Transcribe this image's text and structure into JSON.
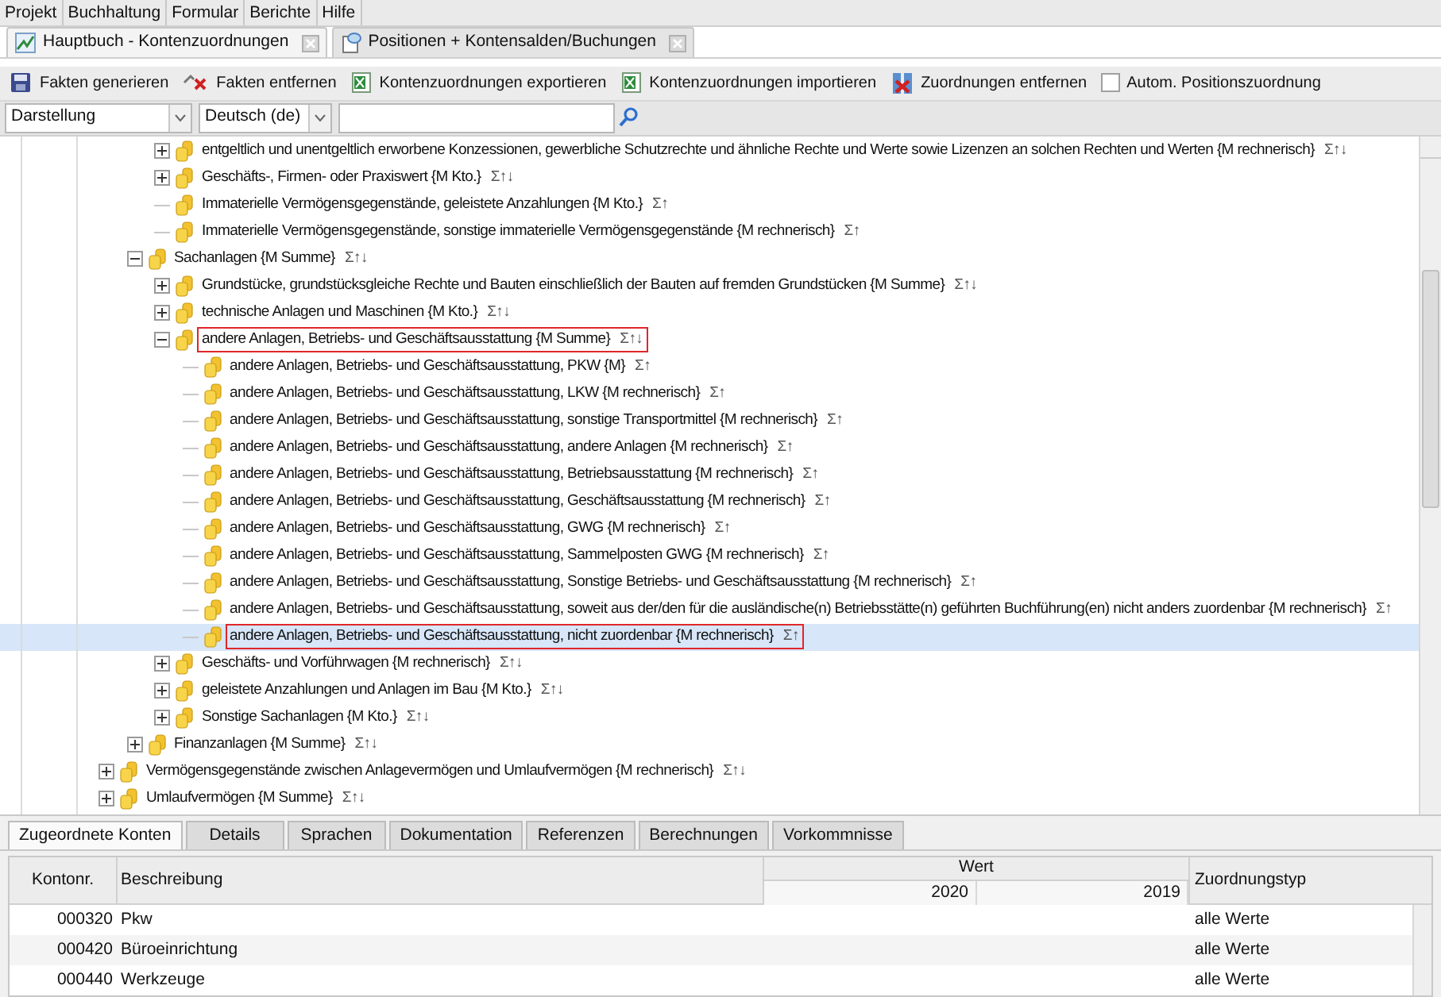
{
  "menu": [
    "Projekt",
    "Buchhaltung",
    "Formular",
    "Berichte",
    "Hilfe"
  ],
  "doc_tabs": [
    {
      "label": "Hauptbuch - Kontenzuordnungen",
      "kind": "ledger",
      "selected": true
    },
    {
      "label": "Positionen + Kontensalden/Buchungen",
      "kind": "positions",
      "selected": false
    }
  ],
  "toolbar": [
    {
      "kind": "generate",
      "label": "Fakten generieren"
    },
    {
      "kind": "remove",
      "label": "Fakten entfernen"
    },
    {
      "kind": "export",
      "label": "Kontenzuordnungen exportieren"
    },
    {
      "kind": "import",
      "label": "Kontenzuordnungen importieren"
    },
    {
      "kind": "unassign",
      "label": "Zuordnungen entfernen"
    },
    {
      "kind": "checkbox",
      "label": "Autom. Positionszuordnung",
      "checked": false
    }
  ],
  "filters": {
    "view": "Darstellung",
    "language": "Deutsch (de)"
  },
  "tree": [
    {
      "children": [
        {
          "children": [
            {
              "label": "entgeltlich und unentgeltlich erworbene Konzessionen, gewerbliche Schutzrechte und ähnliche Rechte und Werte sowie Lizenzen an solchen Rechten und Werten {M rechnerisch}",
              "flags": "Σ↑↓",
              "expanded": false,
              "selected": false,
              "marked": false
            },
            {
              "label": "Geschäfts-, Firmen- oder Praxiswert {M Kto.}",
              "flags": "Σ↑↓",
              "expanded": false,
              "selected": false,
              "marked": false
            },
            {
              "label": "Immaterielle Vermögensgegenstände, geleistete Anzahlungen {M Kto.}",
              "flags": "Σ↑",
              "selected": false,
              "marked": false
            },
            {
              "label": "Immaterielle Vermögensgegenstände, sonstige immaterielle Vermögensgegenstände {M rechnerisch}",
              "flags": "Σ↑",
              "selected": false,
              "marked": false
            }
          ]
        },
        {
          "label": "Sachanlagen {M Summe}",
          "flags": "Σ↑↓",
          "expanded": true,
          "selected": false,
          "marked": false,
          "children": [
            {
              "label": "Grundstücke, grundstücksgleiche Rechte und Bauten einschließlich der Bauten auf fremden Grundstücken {M Summe}",
              "flags": "Σ↑↓",
              "expanded": false,
              "selected": false,
              "marked": false
            },
            {
              "label": "technische Anlagen und Maschinen {M Kto.}",
              "flags": "Σ↑↓",
              "expanded": false,
              "selected": false,
              "marked": false
            },
            {
              "label": "andere Anlagen, Betriebs- und Geschäftsausstattung {M Summe}",
              "flags": "Σ↑↓",
              "expanded": true,
              "selected": false,
              "marked": true,
              "children": [
                {
                  "label": "andere Anlagen, Betriebs- und Geschäftsausstattung, PKW {M}",
                  "flags": "Σ↑",
                  "selected": false,
                  "marked": false
                },
                {
                  "label": "andere Anlagen, Betriebs- und Geschäftsausstattung, LKW {M rechnerisch}",
                  "flags": "Σ↑",
                  "selected": false,
                  "marked": false
                },
                {
                  "label": "andere Anlagen, Betriebs- und Geschäftsausstattung, sonstige Transportmittel {M rechnerisch}",
                  "flags": "Σ↑",
                  "selected": false,
                  "marked": false
                },
                {
                  "label": "andere Anlagen, Betriebs- und Geschäftsausstattung, andere Anlagen {M rechnerisch}",
                  "flags": "Σ↑",
                  "selected": false,
                  "marked": false
                },
                {
                  "label": "andere Anlagen, Betriebs- und Geschäftsausstattung, Betriebsausstattung {M rechnerisch}",
                  "flags": "Σ↑",
                  "selected": false,
                  "marked": false
                },
                {
                  "label": "andere Anlagen, Betriebs- und Geschäftsausstattung, Geschäftsausstattung {M rechnerisch}",
                  "flags": "Σ↑",
                  "selected": false,
                  "marked": false
                },
                {
                  "label": "andere Anlagen, Betriebs- und Geschäftsausstattung, GWG {M rechnerisch}",
                  "flags": "Σ↑",
                  "selected": false,
                  "marked": false
                },
                {
                  "label": "andere Anlagen, Betriebs- und Geschäftsausstattung, Sammelposten GWG {M rechnerisch}",
                  "flags": "Σ↑",
                  "selected": false,
                  "marked": false
                },
                {
                  "label": "andere Anlagen, Betriebs- und Geschäftsausstattung, Sonstige Betriebs- und Geschäftsausstattung {M rechnerisch}",
                  "flags": "Σ↑",
                  "selected": false,
                  "marked": false
                },
                {
                  "label": "andere Anlagen, Betriebs- und Geschäftsausstattung, soweit aus der/den für die ausländische(n) Betriebsstätte(n) geführten Buchführung(en) nicht anders zuordenbar {M rechnerisch}",
                  "flags": "Σ↑",
                  "selected": false,
                  "marked": false
                },
                {
                  "label": "andere Anlagen, Betriebs- und Geschäftsausstattung, nicht zuordenbar {M rechnerisch}",
                  "flags": "Σ↑",
                  "selected": true,
                  "marked": true
                }
              ]
            },
            {
              "label": "Geschäfts- und Vorführwagen {M rechnerisch}",
              "flags": "Σ↑↓",
              "expanded": false,
              "selected": false,
              "marked": false
            },
            {
              "label": "geleistete Anzahlungen und Anlagen im Bau {M Kto.}",
              "flags": "Σ↑↓",
              "expanded": false,
              "selected": false,
              "marked": false
            },
            {
              "label": "Sonstige Sachanlagen {M Kto.}",
              "flags": "Σ↑↓",
              "expanded": false,
              "selected": false,
              "marked": false
            }
          ]
        },
        {
          "label": "Finanzanlagen {M Summe}",
          "flags": "Σ↑↓",
          "expanded": false,
          "selected": false,
          "marked": false
        }
      ]
    },
    {
      "label": "Vermögensgegenstände zwischen Anlagevermögen und Umlaufvermögen {M rechnerisch}",
      "flags": "Σ↑↓",
      "expanded": false,
      "selected": false,
      "marked": false
    },
    {
      "label": "Umlaufvermögen {M Summe}",
      "flags": "Σ↑↓",
      "expanded": false,
      "selected": false,
      "marked": false
    }
  ],
  "bottom_tabs": [
    {
      "label": "Zugeordnete Konten",
      "selected": true
    },
    {
      "label": "Details",
      "selected": false
    },
    {
      "label": "Sprachen",
      "selected": false
    },
    {
      "label": "Dokumentation",
      "selected": false
    },
    {
      "label": "Referenzen",
      "selected": false
    },
    {
      "label": "Berechnungen",
      "selected": false
    },
    {
      "label": "Vorkommnisse",
      "selected": false
    }
  ],
  "table": {
    "columns": {
      "number": "Kontonr.",
      "description": "Beschreibung",
      "value": "Wert",
      "years": [
        "2020",
        "2019"
      ],
      "type": "Zuordnungstyp"
    },
    "rows": [
      {
        "number": "000320",
        "description": "Pkw",
        "type": "alle Werte"
      },
      {
        "number": "000420",
        "description": "Büroeinrichtung",
        "type": "alle Werte"
      },
      {
        "number": "000440",
        "description": "Werkzeuge",
        "type": "alle Werte"
      }
    ]
  }
}
